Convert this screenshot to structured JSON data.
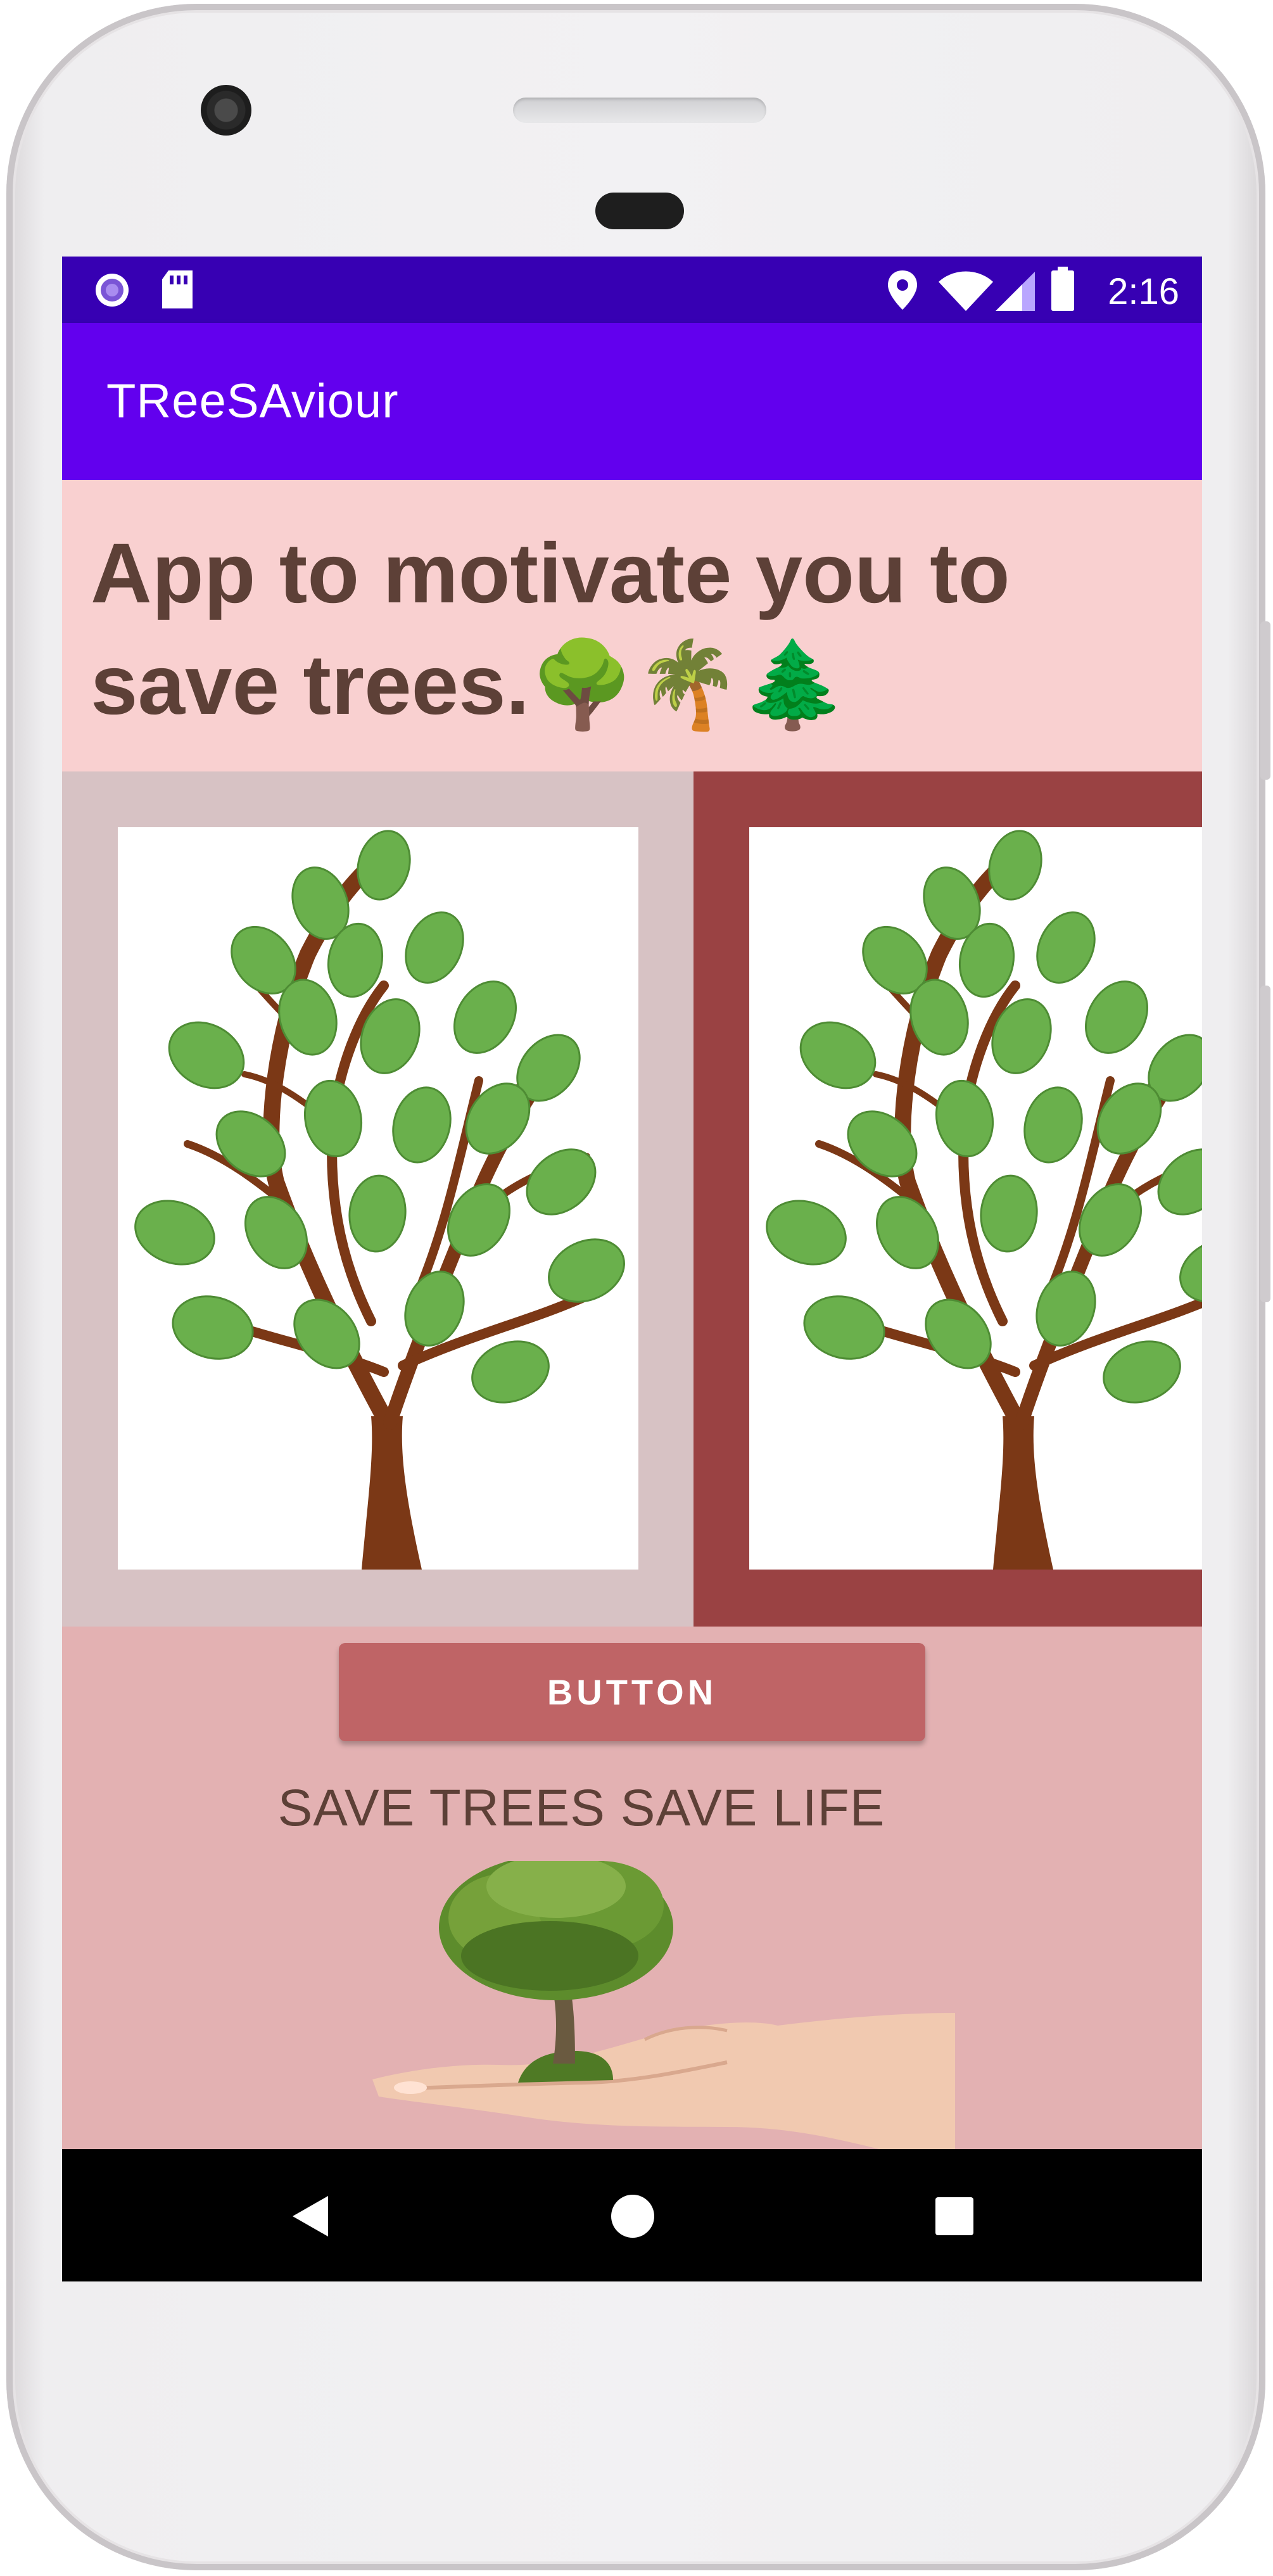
{
  "status_bar": {
    "time": "2:16",
    "icons": [
      "circle-notification-icon",
      "sd-card-icon",
      "location-icon",
      "wifi-icon",
      "signal-icon",
      "battery-icon"
    ]
  },
  "app_bar": {
    "title": "TReeSAviour"
  },
  "content": {
    "headline": "App to motivate you to save trees.",
    "headline_emojis": "🌳🌴🌲",
    "button_label": "BUTTON",
    "tagline": "SAVE TREES SAVE LIFE"
  },
  "nav_bar": {
    "icons": [
      "back-icon",
      "home-icon",
      "recents-icon"
    ]
  },
  "colors": {
    "status_bar": "#3700b3",
    "app_bar": "#6200ee",
    "headline_bg": "#f9d0d0",
    "headline_text": "#5d4037",
    "left_panel": "#d7c2c4",
    "right_panel": "#9a4243",
    "bottom_bg": "#e3b1b2",
    "button": "#bf6466"
  }
}
